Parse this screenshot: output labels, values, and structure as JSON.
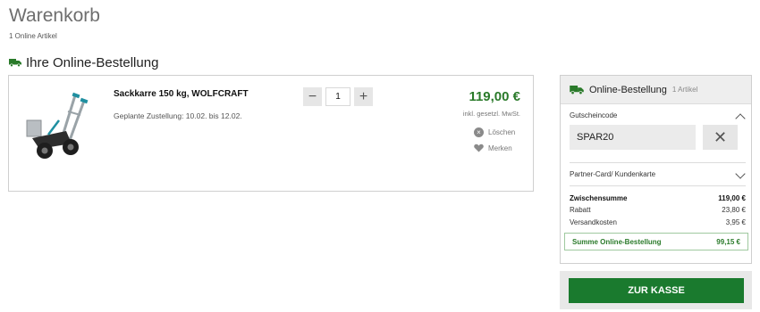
{
  "page": {
    "title": "Warenkorb",
    "subtitle": "1 Online Artikel"
  },
  "section": {
    "title": "Ihre Online-Bestellung",
    "icon": "truck-icon"
  },
  "item": {
    "name": "Sackkarre 150 kg, WOLFCRAFT",
    "delivery": "Geplante Zustellung: 10.02. bis 12.02.",
    "quantity": "1",
    "price": "119,00 €",
    "vat_note": "inkl. gesetzl. MwSt.",
    "delete_label": "Löschen",
    "save_label": "Merken"
  },
  "summary": {
    "title": "Online-Bestellung",
    "count": "1 Artikel",
    "coupon_label": "Gutscheincode",
    "coupon_value": "SPAR20",
    "partner_label": "Partner-Card/ Kundenkarte",
    "lines": [
      {
        "label": "Zwischensumme",
        "value": "119,00 €"
      },
      {
        "label": "Rabatt",
        "value": "23,80 €"
      },
      {
        "label": "Versandkosten",
        "value": "3,95 €"
      }
    ],
    "total_label": "Summe Online-Bestellung",
    "total_value": "99,15 €"
  },
  "checkout": {
    "label": "ZUR KASSE"
  },
  "colors": {
    "accent_green": "#2a7a2a",
    "button_green": "#1a7a2e"
  }
}
